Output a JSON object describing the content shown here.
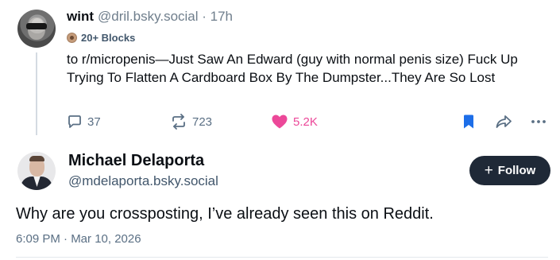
{
  "parent_post": {
    "author_name": "wint",
    "handle_and_time": "@dril.bsky.social · 17h",
    "badge": "20+ Blocks",
    "text": "to r/micropenis—Just Saw An Edward (guy with normal penis size) Fuck Up Trying To Flatten A Cardboard Box By The Dumpster...They Are So Lost",
    "reply_count": "37",
    "repost_count": "723",
    "like_count": "5.2K",
    "icons": [
      "reply-icon",
      "repost-icon",
      "heart-icon",
      "bookmark-icon",
      "share-icon",
      "more-icon"
    ],
    "colors": {
      "like": "#ec4899",
      "bookmark": "#1d6ee8",
      "meta": "#5a6f84"
    }
  },
  "main_post": {
    "author_name": "Michael Delaporta",
    "handle": "@mdelaporta.bsky.social",
    "follow_label": "Follow",
    "text": "Why are you crossposting, I’ve already seen this on Reddit.",
    "timestamp": "6:09 PM · Mar 10, 2026",
    "colors": {
      "follow_bg": "#1f2937"
    }
  }
}
